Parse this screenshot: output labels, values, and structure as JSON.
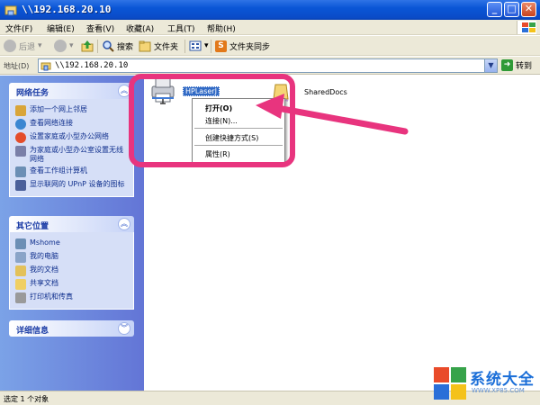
{
  "window": {
    "title": "\\\\192.168.20.10",
    "min_label": "_",
    "max_label": "□",
    "close_label": "✕"
  },
  "menu": {
    "items": [
      "文件(F)",
      "编辑(E)",
      "查看(V)",
      "收藏(A)",
      "工具(T)",
      "帮助(H)"
    ]
  },
  "toolbar": {
    "back_label": "后退",
    "search_label": "搜索",
    "folders_label": "文件夹",
    "sync_label": "文件夹同步"
  },
  "address": {
    "label": "地址(D)",
    "value": "\\\\192.168.20.10",
    "go_label": "转到"
  },
  "tasks": {
    "title": "网络任务",
    "items": [
      "添加一个网上邻居",
      "查看网络连接",
      "设置家庭或小型办公网络",
      "为家庭或小型办公室设置无线网络",
      "查看工作组计算机",
      "显示联网的 UPnP 设备的图标"
    ]
  },
  "places": {
    "title": "其它位置",
    "items": [
      "Mshome",
      "我的电脑",
      "我的文档",
      "共享文档",
      "打印机和传真"
    ]
  },
  "details": {
    "title": "详细信息"
  },
  "files": [
    {
      "name": "HPLaserJ",
      "icon": "printer-icon"
    },
    {
      "name": "SharedDocs",
      "icon": "shared-folder-icon"
    }
  ],
  "context_menu": {
    "items": [
      "打开(O)",
      "连接(N)...",
      "创建快捷方式(S)",
      "属性(R)"
    ]
  },
  "status": {
    "text": "选定 1 个对象"
  },
  "watermark": {
    "brand": "系统大全",
    "url": "WWW.XP85.COM"
  },
  "colors": {
    "highlight": "#e8347e",
    "title_bar": "#0a56d6",
    "task_pane": "#7ba2e7"
  }
}
